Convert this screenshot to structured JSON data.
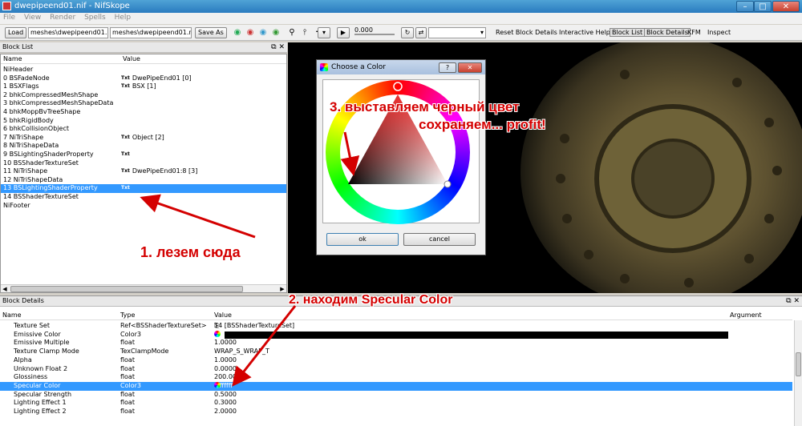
{
  "window": {
    "title": "dwepipeend01.nif - NifSkope",
    "btn_min": "–",
    "btn_max": "□",
    "btn_close": "✕"
  },
  "menu": [
    "File",
    "View",
    "Render",
    "Spells",
    "Help"
  ],
  "toolbar": {
    "load_label": "Load",
    "path1": "meshes\\dwepipeend01.nif",
    "path2": "meshes\\dwepipeend01.nif",
    "save_label": "Save As",
    "time_value": "0.000",
    "reset_label": "Reset Block Details",
    "help_label": "Interactive Help",
    "blocklist_label": "Block List",
    "blockdetails_label": "Block Details",
    "kfm_label": "KFM",
    "inspect_label": "Inspect"
  },
  "block_list": {
    "title": "Block List",
    "col_name": "Name",
    "col_value": "Value",
    "txt_tag": "Txt",
    "rows": [
      {
        "name": "NiHeader",
        "value": "",
        "txt": false
      },
      {
        "name": "0 BSFadeNode",
        "value": "DwePipeEnd01 [0]",
        "txt": true
      },
      {
        "name": "1 BSXFlags",
        "value": "BSX [1]",
        "txt": true
      },
      {
        "name": "2 bhkCompressedMeshShape",
        "value": "",
        "txt": false
      },
      {
        "name": "3 bhkCompressedMeshShapeData",
        "value": "",
        "txt": false
      },
      {
        "name": "4 bhkMoppBvTreeShape",
        "value": "",
        "txt": false
      },
      {
        "name": "5 bhkRigidBody",
        "value": "",
        "txt": false
      },
      {
        "name": "6 bhkCollisionObject",
        "value": "",
        "txt": false
      },
      {
        "name": "7 NiTriShape",
        "value": "Object [2]",
        "txt": true
      },
      {
        "name": "8 NiTriShapeData",
        "value": "",
        "txt": false
      },
      {
        "name": "9 BSLightingShaderProperty",
        "value": "",
        "txt": true
      },
      {
        "name": "10 BSShaderTextureSet",
        "value": "",
        "txt": false
      },
      {
        "name": "11 NiTriShape",
        "value": "DwePipeEnd01:8 [3]",
        "txt": true
      },
      {
        "name": "12 NiTriShapeData",
        "value": "",
        "txt": false
      },
      {
        "name": "13 BSLightingShaderProperty",
        "value": "",
        "txt": true,
        "selected": true
      },
      {
        "name": "14 BSShaderTextureSet",
        "value": "",
        "txt": false
      },
      {
        "name": "NiFooter",
        "value": "",
        "txt": false
      }
    ]
  },
  "block_details": {
    "title": "Block Details",
    "col_name": "Name",
    "col_type": "Type",
    "col_value": "Value",
    "col_argument": "Argument",
    "rows": [
      {
        "name": "Texture Set",
        "type": "Ref<BSShaderTextureSet>",
        "value": "14 [BSShaderTextureSet]",
        "icon": "link"
      },
      {
        "name": "Emissive Color",
        "type": "Color3",
        "value": "",
        "icon": "color",
        "swatch": "#000000"
      },
      {
        "name": "Emissive Multiple",
        "type": "float",
        "value": "1.0000"
      },
      {
        "name": "Texture Clamp Mode",
        "type": "TexClampMode",
        "value": "WRAP_S_WRAP_T"
      },
      {
        "name": "Alpha",
        "type": "float",
        "value": "1.0000"
      },
      {
        "name": "Unknown Float 2",
        "type": "float",
        "value": "0.0000"
      },
      {
        "name": "Glossiness",
        "type": "float",
        "value": "200.0000"
      },
      {
        "name": "Specular Color",
        "type": "Color3",
        "value": "#ffffff",
        "icon": "color",
        "selected": true
      },
      {
        "name": "Specular Strength",
        "type": "float",
        "value": "0.5000"
      },
      {
        "name": "Lighting Effect 1",
        "type": "float",
        "value": "0.3000"
      },
      {
        "name": "Lighting Effect 2",
        "type": "float",
        "value": "2.0000"
      }
    ]
  },
  "dialog": {
    "title": "Choose a Color",
    "help": "?",
    "close": "✕",
    "ok_label": "ok",
    "cancel_label": "cancel"
  },
  "annotations": {
    "step1": "1. лезем сюда",
    "step2": "2. находим Specular Color",
    "step3_line1": "3. выставляем черный цвет",
    "step3_line2": "сохраняем... profit!"
  },
  "colors": {
    "selection": "#3399ff",
    "annotation": "#d40000",
    "title_bar": "#2a7bbf"
  }
}
